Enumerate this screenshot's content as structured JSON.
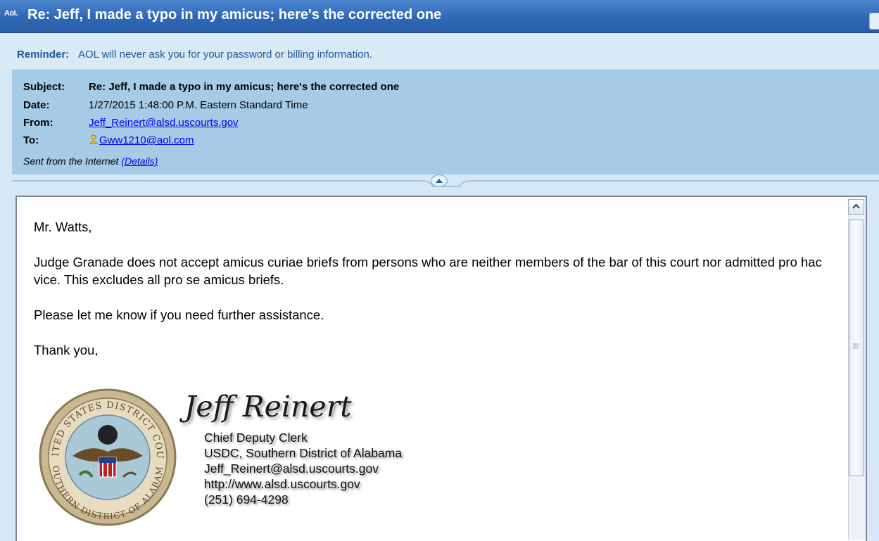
{
  "window": {
    "app_icon": "aol-icon",
    "app_icon_text": "Aol.",
    "title": "Re: Jeff, I made a typo in my amicus; here's the corrected one"
  },
  "reminder": {
    "label": "Reminder:",
    "text": "AOL will never ask you for your password or billing information."
  },
  "header": {
    "subject_label": "Subject:",
    "subject": "Re: Jeff, I made a typo in my amicus; here's the corrected one",
    "date_label": "Date:",
    "date": "1/27/2015 1:48:00 P.M. Eastern Standard Time",
    "from_label": "From:",
    "from": "Jeff_Reinert@alsd.uscourts.gov",
    "to_label": "To:",
    "to": "Gww1210@aol.com",
    "sent_from": "Sent from the Internet",
    "details_link": "(Details)"
  },
  "body": {
    "greeting": "Mr. Watts,",
    "paragraph1": "Judge Granade does not accept amicus curiae briefs from persons who are neither members of the bar of this court nor admitted pro hac vice. This excludes all pro se amicus briefs.",
    "paragraph2": "Please let me know if you need further assistance.",
    "closing": "Thank you,"
  },
  "signature": {
    "name": "Jeff Reinert",
    "title": "Chief Deputy Clerk",
    "office": "USDC, Southern District of Alabama",
    "email": "Jeff_Reinert@alsd.uscourts.gov",
    "website": "http://www.alsd.uscourts.gov",
    "phone": "(251) 694-4298",
    "seal_text_top": "UNITED STATES DISTRICT COURT",
    "seal_text_bottom": "SOUTHERN DISTRICT OF ALABAMA"
  },
  "colors": {
    "titlebar": "#2f68b6",
    "header_bg": "#a6cbe6",
    "reminder_text": "#1a5a9a",
    "link": "#0000ee"
  }
}
